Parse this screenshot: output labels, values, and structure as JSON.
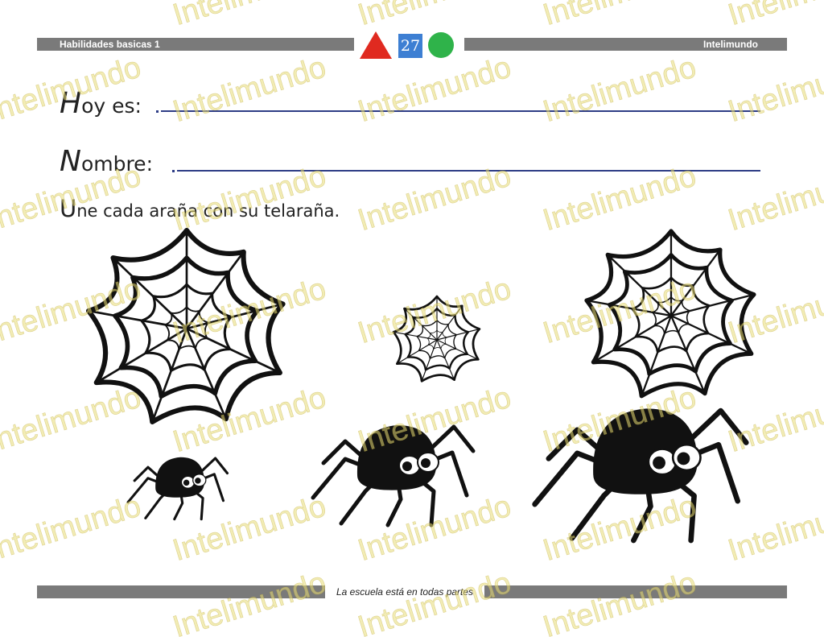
{
  "header": {
    "left_title": "Habilidades basicas 1",
    "page_number": "27",
    "right_title": "Intelimundo",
    "shape_colors": {
      "triangle": "#e02a20",
      "square": "#3d7fd3",
      "circle": "#2fb34a"
    }
  },
  "form": {
    "date_initial": "H",
    "date_rest": "oy es:",
    "name_initial": "N",
    "name_rest": "ombre:"
  },
  "instruction": {
    "initial": "U",
    "rest": "ne cada araña con su telaraña."
  },
  "worksheet": {
    "webs": [
      "large",
      "small",
      "large"
    ],
    "spiders": [
      "small",
      "medium",
      "large"
    ]
  },
  "footer": {
    "slogan": "La escuela está en todas partes"
  },
  "watermark": {
    "text": "Intelimundo",
    "color": "#e8dc78"
  }
}
